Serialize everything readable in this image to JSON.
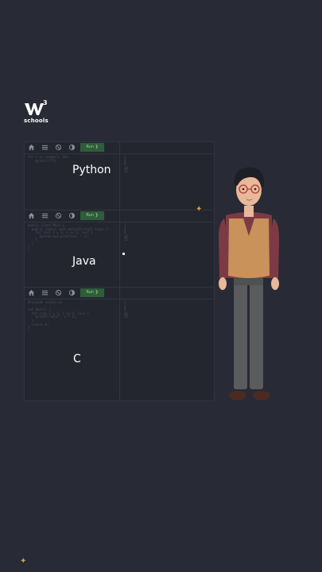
{
  "logo": {
    "superscript": "3",
    "word": "schools"
  },
  "editors": [
    {
      "run_label": "Run ❯",
      "code": "for i in range(1, 10):\n    print(i**2)",
      "output": "1\n4\n9\n16\n25",
      "language": "Python"
    },
    {
      "run_label": "Run ❯",
      "code": "public class Main {\n  public static void main(String[] args) {\n    for (int i = 1; i <= 5; i++) {\n      System.out.println(i * i);\n    }\n  }\n}",
      "output": "1\n4\n9\n16\n25",
      "language": "Java"
    },
    {
      "run_label": "Run ❯",
      "code": "#include <stdio.h>\n\nint main() {\n  for (int i = 1; i <= 5; i++) {\n    printf(\"%d\\n\", i * i);\n  }\n  return 0;\n}",
      "output": "1\n4\n9\n16\n25",
      "language": "C"
    }
  ],
  "colors": {
    "background": "#282a35",
    "editor_bg": "#24262f",
    "run_button": "#2e5d3a",
    "sparkle": "#d6a33d",
    "vest": "#c8925a",
    "shirt": "#7e3a44",
    "trousers": "#595b5c"
  },
  "icons": [
    "w3schools-logo-icon",
    "home-icon",
    "menu-icon",
    "theme-icon",
    "contrast-icon",
    "sparkle-icon",
    "teacher-character"
  ]
}
